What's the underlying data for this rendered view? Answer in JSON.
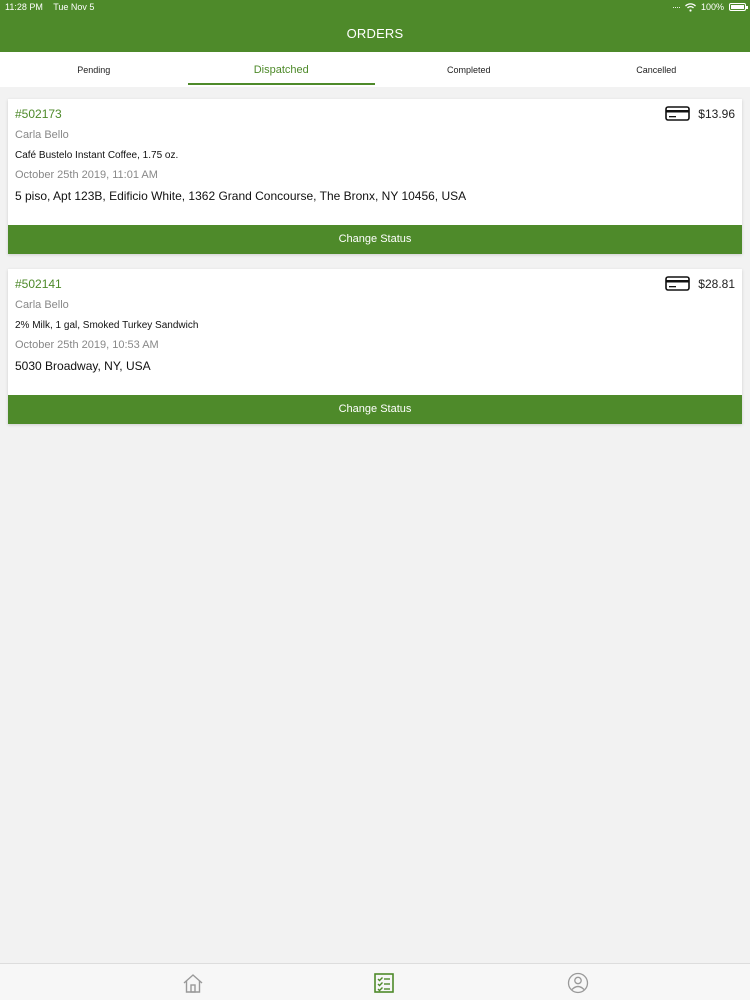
{
  "status_bar": {
    "time": "11:28 PM",
    "date": "Tue Nov 5",
    "battery": "100%"
  },
  "header": {
    "title": "ORDERS"
  },
  "tabs": [
    {
      "label": "Pending"
    },
    {
      "label": "Dispatched"
    },
    {
      "label": "Completed"
    },
    {
      "label": "Cancelled"
    }
  ],
  "active_tab": "Dispatched",
  "orders": [
    {
      "number": "#502173",
      "price": "$13.96",
      "customer": "Carla Bello",
      "items": "Café Bustelo Instant Coffee, 1.75 oz.",
      "date": "October 25th 2019, 11:01 AM",
      "address": "5 piso, Apt 123B, Edificio White, 1362 Grand Concourse, The Bronx, NY 10456, USA",
      "button": "Change Status"
    },
    {
      "number": "#502141",
      "price": "$28.81",
      "customer": "Carla Bello",
      "items": "2% Milk, 1 gal, Smoked Turkey Sandwich",
      "date": "October 25th 2019, 10:53 AM",
      "address": "5030 Broadway, NY, USA",
      "button": "Change Status"
    }
  ],
  "bottom_nav": [
    {
      "icon": "home-icon"
    },
    {
      "icon": "orders-checklist-icon"
    },
    {
      "icon": "profile-icon"
    }
  ],
  "colors": {
    "brand": "#4e8a2a",
    "background": "#f2f2f2"
  }
}
